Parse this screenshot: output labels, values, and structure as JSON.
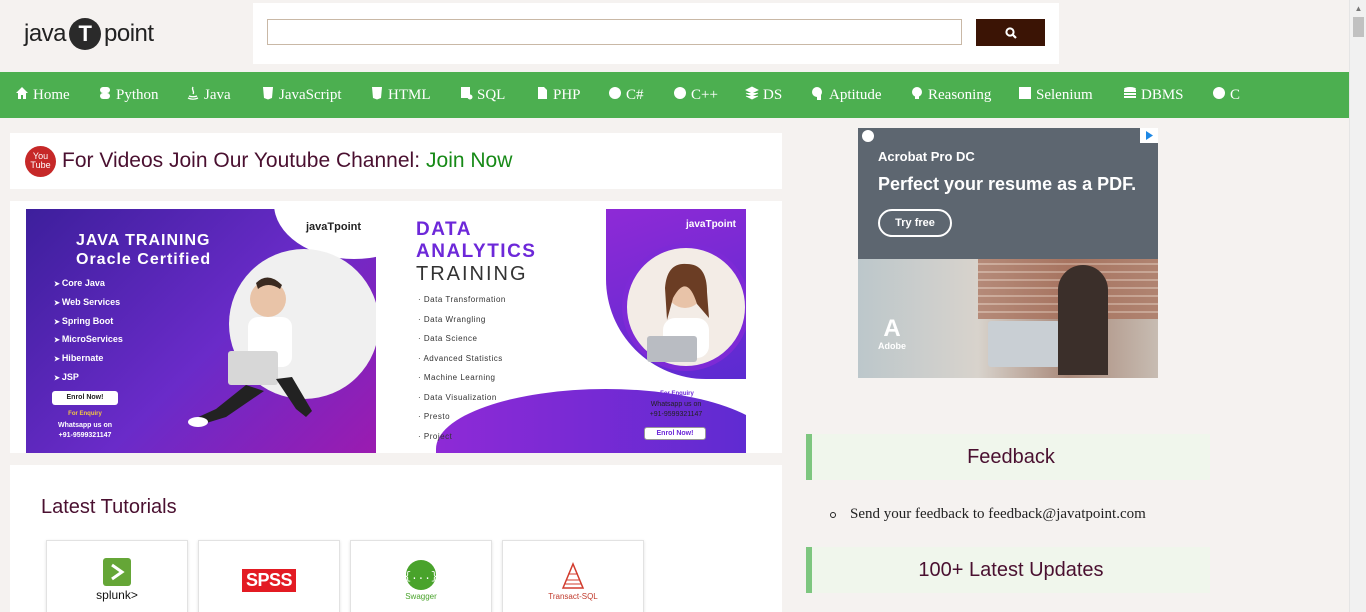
{
  "header": {
    "logo_left": "java",
    "logo_mark": "T",
    "logo_right": "point",
    "search": {
      "placeholder": "",
      "value": ""
    }
  },
  "nav": {
    "items": [
      {
        "label": "Home",
        "icon": "home-icon"
      },
      {
        "label": "Python",
        "icon": "python-icon"
      },
      {
        "label": "Java",
        "icon": "java-icon"
      },
      {
        "label": "JavaScript",
        "icon": "javascript-icon"
      },
      {
        "label": "HTML",
        "icon": "html5-icon"
      },
      {
        "label": "SQL",
        "icon": "sql-icon"
      },
      {
        "label": "PHP",
        "icon": "php-icon"
      },
      {
        "label": "C#",
        "icon": "csharp-icon"
      },
      {
        "label": "C++",
        "icon": "cpp-icon"
      },
      {
        "label": "DS",
        "icon": "ds-icon"
      },
      {
        "label": "Aptitude",
        "icon": "aptitude-icon"
      },
      {
        "label": "Reasoning",
        "icon": "reasoning-icon"
      },
      {
        "label": "Selenium",
        "icon": "selenium-icon"
      },
      {
        "label": "DBMS",
        "icon": "database-icon"
      },
      {
        "label": "C",
        "icon": "c-icon"
      }
    ],
    "bg_color": "#4caf50"
  },
  "youtube": {
    "icon_text_top": "You",
    "icon_text_bottom": "Tube",
    "text": "For Videos Join Our Youtube Channel:",
    "link": "Join Now"
  },
  "banner_java": {
    "brand": "javaTpoint",
    "title_line1": "JAVA TRAINING",
    "title_line2": "Oracle Certified",
    "items": [
      "Core Java",
      "Web Services",
      "Spring Boot",
      "MicroServices",
      "Hibernate",
      "JSP"
    ],
    "enrol": "Enrol Now!",
    "enquiry": "For Enquiry",
    "whatsapp": "Whatsapp us on",
    "phone": "+91-9599321147"
  },
  "banner_data": {
    "brand": "javaTpoint",
    "title_line1": "DATA",
    "title_line2": "ANALYTICS",
    "subtitle": "TRAINING",
    "items": [
      "Data Transformation",
      "Data Wrangling",
      "Data Science",
      "Advanced Statistics",
      "Machine Learning",
      "Data Visualization",
      "Presto",
      "Project"
    ],
    "enquiry": "For Enquiry",
    "whatsapp": "Whatsapp us on",
    "phone": "+91-9599321147",
    "enrol": "Enrol Now!"
  },
  "tutorials": {
    "heading": "Latest Tutorials",
    "cards": [
      {
        "label": "splunk>",
        "icon": "splunk-icon"
      },
      {
        "label": "SPSS",
        "icon": "spss-icon"
      },
      {
        "label": "Swagger",
        "icon": "swagger-icon"
      },
      {
        "label": "Transact-SQL",
        "icon": "tsql-icon"
      }
    ]
  },
  "ad": {
    "brand": "Acrobat Pro DC",
    "headline": "Perfect your resume as a PDF.",
    "button": "Try free",
    "logo_text": "Adobe"
  },
  "sidebar": {
    "feedback_title": "Feedback",
    "feedback_text": "Send your feedback to feedback@javatpoint.com",
    "updates_title": "100+ Latest Updates"
  }
}
